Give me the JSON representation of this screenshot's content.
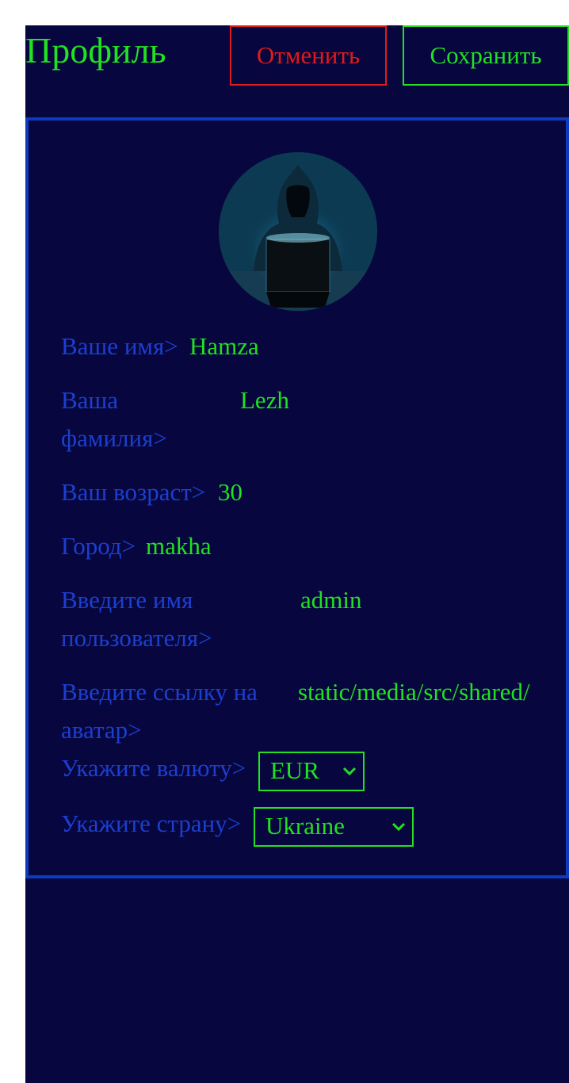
{
  "header": {
    "title": "Профиль",
    "cancel_label": "Отменить",
    "save_label": "Сохранить"
  },
  "profile": {
    "avatar_alt": "hooded figure at laptop",
    "fields": {
      "first_name": {
        "label": "Ваше имя>",
        "value": "Hamza"
      },
      "last_name": {
        "label_line1": "Ваша",
        "label_line2": "фамилия>",
        "value": "Lezh"
      },
      "age": {
        "label": "Ваш возраст>",
        "value": "30"
      },
      "city": {
        "label": "Город>",
        "value": "makha"
      },
      "username": {
        "label_line1": "Введите имя",
        "label_line2": "пользователя>",
        "value": "admin"
      },
      "avatar_link": {
        "label_line1": "Введите ссылку на",
        "label_line2": "аватар>",
        "value": "static/media/src/shared/"
      },
      "currency": {
        "label": "Укажите валюту>",
        "selected": "EUR"
      },
      "country": {
        "label": "Укажите страну>",
        "selected": "Ukraine"
      }
    }
  },
  "colors": {
    "background": "#07063e",
    "accent_green": "#22e022",
    "label_blue": "#1c3fd0",
    "border_blue": "#0c3bbf",
    "cancel_red": "#e01b1b"
  },
  "icons": {
    "select_arrow": "chevron-down-icon"
  }
}
